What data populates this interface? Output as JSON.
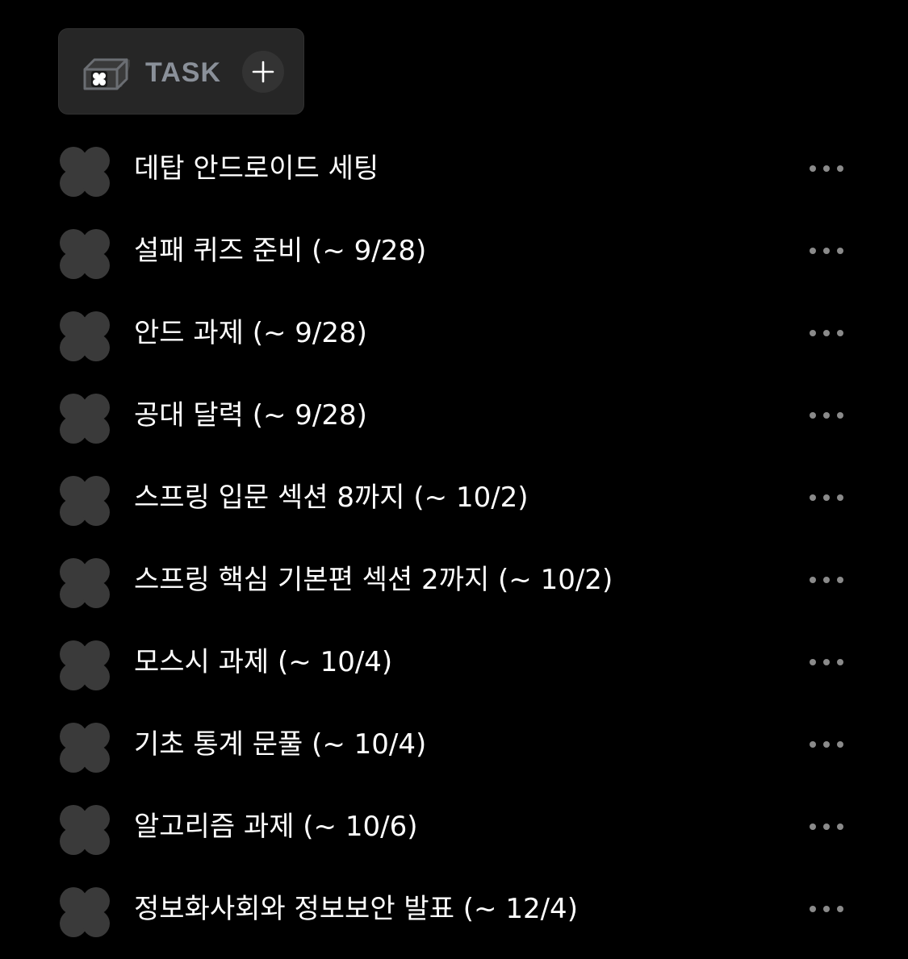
{
  "header": {
    "title": "TASK",
    "icon": "mailbox-icon",
    "add_icon": "plus-icon"
  },
  "colors": {
    "background": "#000000",
    "header_bg": "#262626",
    "title": "#8a9099",
    "flower": "#3a3a3a",
    "text": "#ffffff",
    "dots": "#8a8a8a"
  },
  "tasks": [
    {
      "label": "데탑 안드로이드 세팅"
    },
    {
      "label": "설패 퀴즈 준비 (~ 9/28)"
    },
    {
      "label": "안드 과제 (~ 9/28)"
    },
    {
      "label": "공대 달력 (~ 9/28)"
    },
    {
      "label": "스프링 입문 섹션 8까지 (~ 10/2)"
    },
    {
      "label": "스프링 핵심 기본편 섹션 2까지 (~ 10/2)"
    },
    {
      "label": "모스시 과제 (~ 10/4)"
    },
    {
      "label": "기초 통계 문풀 (~ 10/4)"
    },
    {
      "label": "알고리즘 과제 (~ 10/6)"
    },
    {
      "label": "정보화사회와 정보보안 발표 (~ 12/4)"
    }
  ]
}
